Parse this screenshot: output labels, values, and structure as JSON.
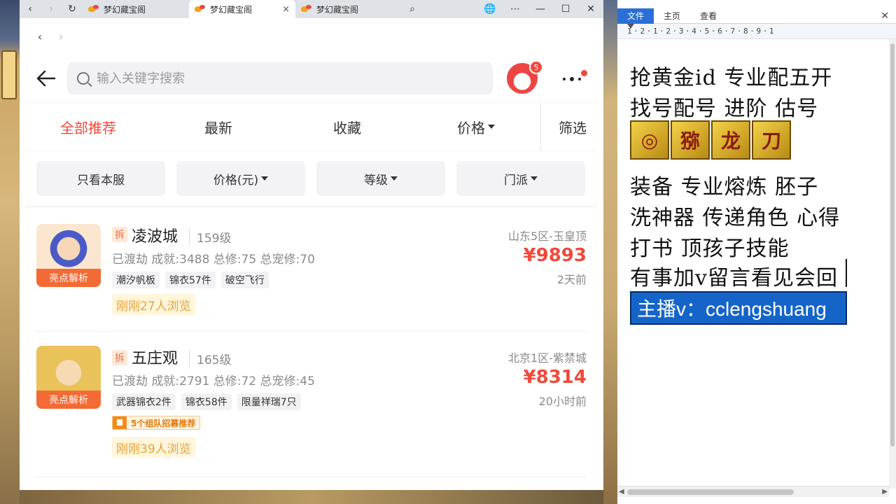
{
  "browser": {
    "tabs": [
      {
        "title": "梦幻藏宝阁",
        "active": false
      },
      {
        "title": "梦幻藏宝阁",
        "active": true
      },
      {
        "title": "梦幻藏宝阁",
        "active": false
      }
    ],
    "tab_close": "×",
    "nav": {
      "back": "‹",
      "forward": "›",
      "reload": "↻"
    },
    "window_controls": {
      "globe": "🌐",
      "more": "⋯",
      "minimize": "—",
      "maximize": "☐",
      "close": "✕"
    }
  },
  "app": {
    "search_placeholder": "输入关键字搜索",
    "notification_count": "5",
    "tabs": [
      {
        "label": "全部推荐",
        "active": true
      },
      {
        "label": "最新"
      },
      {
        "label": "收藏"
      },
      {
        "label": "价格"
      },
      {
        "label": "筛选"
      }
    ],
    "filters": [
      "只看本服",
      "价格(元)",
      "等级",
      "门派"
    ],
    "items": [
      {
        "badge": "亮点解析",
        "chai": "拆",
        "name": "凌波城",
        "level": "159级",
        "stats": "已渡劫 成就:3488 总修:75 总宠修:70",
        "tags": [
          "潮汐帆板",
          "锦衣57件",
          "破空飞行"
        ],
        "recruit": "",
        "views": "刚刚27人浏览",
        "server": "山东5区-玉皇顶",
        "price": "¥9893",
        "time": "2天前"
      },
      {
        "badge": "亮点解析",
        "chai": "拆",
        "name": "五庄观",
        "level": "165级",
        "stats": "已渡劫 成就:2791 总修:72 总宠修:45",
        "tags": [
          "武器锦衣2件",
          "锦衣58件",
          "限量祥瑞7只"
        ],
        "recruit": "5个组队招募推荐",
        "views": "刚刚39人浏览",
        "server": "北京1区-紫禁城",
        "price": "¥8314",
        "time": "20小时前"
      }
    ]
  },
  "editor": {
    "ribbon_tabs": [
      {
        "label": "文件",
        "active": true
      },
      {
        "label": "主页"
      },
      {
        "label": "查看"
      }
    ],
    "ribbon_close": "✕",
    "ruler": "1·2·1·2·3·4·5·6·7·8·9·1",
    "lines": [
      "抢黄金id 专业配五开",
      "找号配号 进阶 估号",
      "装备 专业熔炼 胚子",
      "洗神器 传递角色 心得",
      "打书 顶孩子技能",
      "有事加v留言看见会回"
    ],
    "emblems": [
      "◎",
      "猕",
      "龙",
      "刀"
    ],
    "highlight": "主播v：cclengshuang"
  }
}
